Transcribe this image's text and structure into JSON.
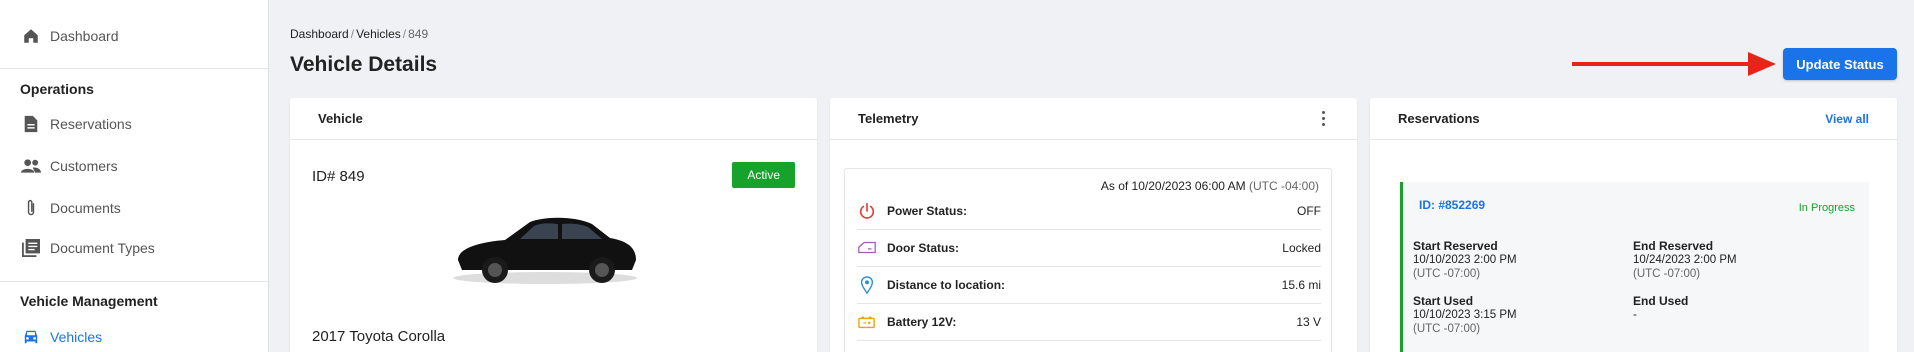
{
  "sidebar": {
    "dashboard": "Dashboard",
    "section_operations": "Operations",
    "operations": [
      {
        "label": "Reservations",
        "icon": "document-icon"
      },
      {
        "label": "Customers",
        "icon": "people-icon"
      },
      {
        "label": "Documents",
        "icon": "paperclip-icon"
      },
      {
        "label": "Document Types",
        "icon": "library-icon"
      }
    ],
    "section_vehicle_mgmt": "Vehicle Management",
    "vehicles": "Vehicles"
  },
  "breadcrumb": [
    "Dashboard",
    "Vehicles",
    "849"
  ],
  "page_title": "Vehicle Details",
  "update_status_label": "Update Status",
  "vehicle_card": {
    "header": "Vehicle",
    "id": "ID# 849",
    "status": "Active",
    "name": "2017 Toyota Corolla"
  },
  "telemetry_card": {
    "header": "Telemetry",
    "as_of": "As of 10/20/2023 06:00 AM",
    "as_of_tz": "(UTC -04:00)",
    "rows": [
      {
        "label": "Power Status:",
        "value": "OFF",
        "icon": "power-icon"
      },
      {
        "label": "Door Status:",
        "value": "Locked",
        "icon": "car-door-icon"
      },
      {
        "label": "Distance to location:",
        "value": "15.6 mi",
        "icon": "location-pin-icon"
      },
      {
        "label": "Battery 12V:",
        "value": "13 V",
        "icon": "battery-icon"
      }
    ]
  },
  "reservations_card": {
    "header": "Reservations",
    "view_all": "View all",
    "reservation": {
      "id": "ID: #852269",
      "status": "In Progress",
      "start_reserved_label": "Start Reserved",
      "start_reserved": "10/10/2023 2:00 PM",
      "start_reserved_tz": "(UTC -07:00)",
      "end_reserved_label": "End Reserved",
      "end_reserved": "10/24/2023 2:00 PM",
      "end_reserved_tz": "(UTC -07:00)",
      "start_used_label": "Start Used",
      "start_used": "10/10/2023 3:15 PM",
      "start_used_tz": "(UTC -07:00)",
      "end_used_label": "End Used",
      "end_used": "-"
    }
  },
  "colors": {
    "accent": "#1a73e8",
    "active_green": "#17a22b",
    "arrow_red": "#e8231a"
  }
}
